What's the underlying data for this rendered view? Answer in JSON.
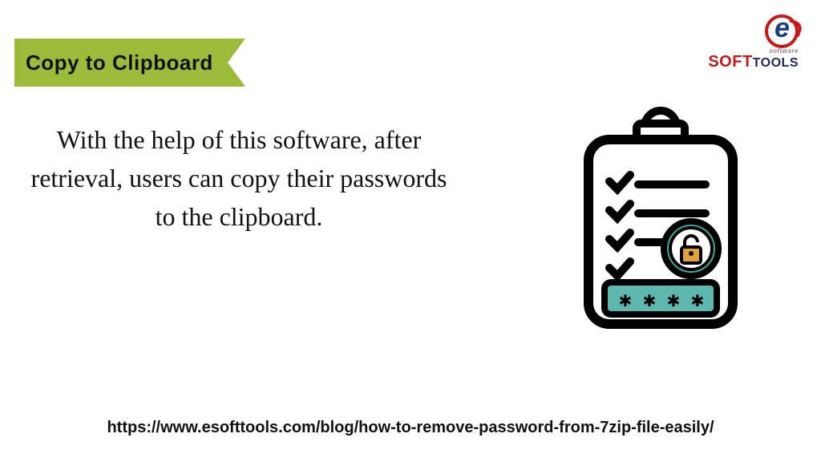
{
  "ribbon": {
    "title": "Copy to Clipboard"
  },
  "logo": {
    "part1": "SOFT",
    "part2": "TOOLS",
    "sub": "software"
  },
  "body": {
    "text": "With the help of this software, after retrieval, users can copy their passwords to the clipboard."
  },
  "url": "https://www.esofttools.com/blog/how-to-remove-password-from-7zip-file-easily/"
}
